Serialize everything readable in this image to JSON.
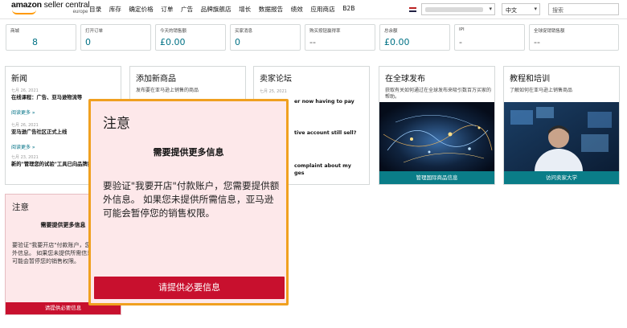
{
  "header": {
    "logo_text": "amazon seller central",
    "logo_region": "europe",
    "nav_items": [
      "目录",
      "库存",
      "确定价格",
      "订单",
      "广告",
      "品牌旗舰店",
      "增长",
      "数据报告",
      "绩效",
      "应用商店",
      "B2B"
    ],
    "language": "中文",
    "search_placeholder": "搜索"
  },
  "metrics": [
    {
      "label": "商城",
      "value": "8"
    },
    {
      "label": "打开订单",
      "value": "0"
    },
    {
      "label": "今天的销售额",
      "value": "£0.00"
    },
    {
      "label": "买家消息",
      "value": "0"
    },
    {
      "label": "购买按钮赢得率",
      "value": "--"
    },
    {
      "label": "总余额",
      "value": "£0.00"
    },
    {
      "label": "IPI",
      "value": "-"
    },
    {
      "label": "全球促销销售额",
      "value": "--"
    }
  ],
  "news": {
    "title": "新闻",
    "items": [
      {
        "date": "七月 26, 2021",
        "title": "在线课程：广告、亚马逊物流等",
        "more": "阅读更多 »"
      },
      {
        "date": "七月 26, 2021",
        "title": "亚马逊广告社区正式上线",
        "more": "阅读更多 »"
      },
      {
        "date": "七月 23, 2021",
        "title": "新的\"管理您的试验\"工具已向品牌推出",
        "more": "阅读更多 »"
      }
    ]
  },
  "add_product": {
    "title": "添加新商品",
    "desc": "发布要在亚马逊上销售的商品"
  },
  "forum": {
    "title": "卖家论坛",
    "date": "七月 25, 2021",
    "snippets": [
      "er now having to pay",
      "tive account still sell?",
      "complaint about my",
      "ges"
    ]
  },
  "global": {
    "title": "在全球发布",
    "desc": "获取有关如何通过在全球发布来吸引数百万买家的帮助。",
    "button": "管理国际商品信息"
  },
  "tutorial": {
    "title": "教程和培训",
    "desc": "了解如何在亚马逊上销售商品",
    "button": "访问卖家大学"
  },
  "small_notice": {
    "title": "注意",
    "subtitle": "需要提供更多信息",
    "body": "要验证\"我要开店\"付款账户，您需要提供额外信息。 如果您未提供所需信息，亚马逊可能会暂停您的销售权限。",
    "button": "请提供必要信息"
  },
  "modal": {
    "title": "注意",
    "subtitle": "需要提供更多信息",
    "body": "要验证\"我要开店\"付款账户，您需要提供额外信息。 如果您未提供所需信息，亚马逊可能会暂停您的销售权限。",
    "button": "请提供必要信息"
  },
  "colors": {
    "accent_teal": "#007185",
    "button_teal": "#0a7d88",
    "alert_red": "#c8102e",
    "alert_bg": "#fde8ea",
    "highlight_orange": "#f0a020"
  }
}
